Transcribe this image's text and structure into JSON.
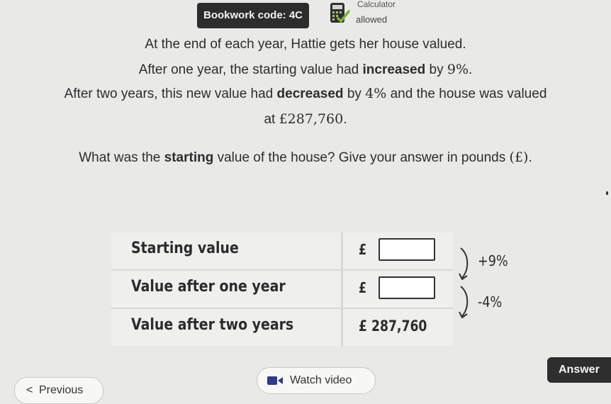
{
  "header": {
    "bookwork": "Bookwork code: 4C",
    "calculator_title": "Calculator",
    "calculator_status": "allowed"
  },
  "question": {
    "line1": "At the end of each year, Hattie gets her house valued.",
    "line2_pre": "After one year, the starting value had ",
    "line2_bold": "increased",
    "line2_mid": " by ",
    "line2_pct": "9%",
    "line2_end": ".",
    "line3_pre": "After two years, this new value had ",
    "line3_bold": "decreased",
    "line3_mid": " by ",
    "line3_pct": "4%",
    "line3_end": " and the house was valued",
    "line4_pre": "at ",
    "line4_val": "£287,760",
    "line4_end": ".",
    "ask_pre": "What was the ",
    "ask_bold": "starting",
    "ask_mid": " value of the house? Give your answer in pounds ",
    "ask_unit": "(£)",
    "ask_end": "."
  },
  "table": {
    "rows": [
      {
        "label": "Starting value",
        "currency": "£",
        "value": ""
      },
      {
        "label": "Value after one year",
        "currency": "£",
        "value": ""
      },
      {
        "label": "Value after two years",
        "value": "£ 287,760"
      }
    ],
    "changes": [
      "+9%",
      "-4%"
    ]
  },
  "buttons": {
    "answer": "Answer",
    "watch_video": "Watch video",
    "previous": "Previous",
    "previous_chevron": "<"
  },
  "icons": {
    "calculator": "calculator-icon",
    "watch_video": "video-icon",
    "previous": "chevron-left-icon",
    "arrow": "curved-arrow-icon"
  },
  "colors": {
    "background": "#e9e9e7",
    "dark_button": "#2e2e2e",
    "table_row": "#efefed"
  }
}
